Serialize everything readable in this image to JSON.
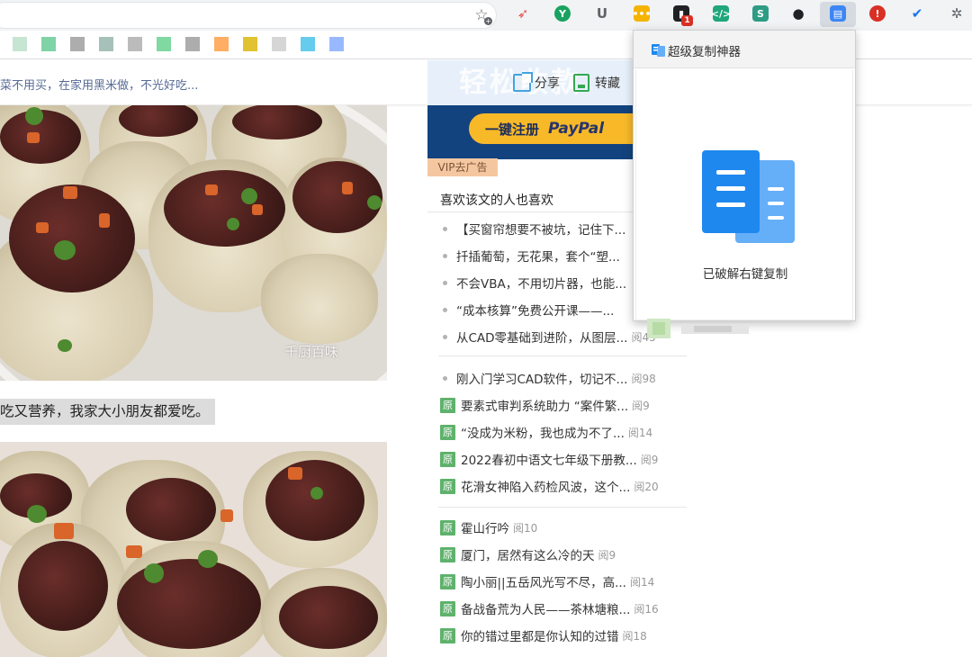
{
  "browser": {
    "extensions": [
      {
        "name": "rocket-extension",
        "color": "#e84b4b",
        "glyph": "➶"
      },
      {
        "name": "y-extension",
        "color": "#1aa260",
        "glyph": "Y"
      },
      {
        "name": "shield-extension",
        "color": "#5f6368",
        "glyph": "U"
      },
      {
        "name": "yellow-dots-extension",
        "color": "#f4b400",
        "glyph": "•••"
      },
      {
        "name": "black-extension",
        "color": "#202124",
        "glyph": "▮"
      },
      {
        "name": "code-extension",
        "color": "#1fa67a",
        "glyph": "</>"
      },
      {
        "name": "s-extension",
        "color": "#2e9c85",
        "glyph": "S"
      },
      {
        "name": "spy-extension",
        "color": "#202124",
        "glyph": "●"
      },
      {
        "name": "copy-extension",
        "color": "#3d86f4",
        "glyph": "▤"
      },
      {
        "name": "alert-extension",
        "color": "#d93025",
        "glyph": "!"
      },
      {
        "name": "check-extension",
        "color": "#1a73e8",
        "glyph": "✔"
      },
      {
        "name": "puzzle-extension",
        "color": "#5f6368",
        "glyph": "✲"
      }
    ],
    "badge_count": "1",
    "bookmark_colors": [
      "#b9dfc8",
      "#5fc890",
      "#999999",
      "#8fb1a8",
      "#aaaaaa",
      "#5fcf8a",
      "#999999",
      "#ff9a3c",
      "#d9b300",
      "#cccccc",
      "#3fbfe8",
      "#7fa7ff"
    ]
  },
  "article": {
    "header_text": "菜不用买，在家用黑米做，不光好吃...",
    "share_label": "分享",
    "collect_label": "转藏",
    "caption": "吃又营养，我家大小朋友都爱吃。",
    "watermark": "千厨百味"
  },
  "ad": {
    "slogan": "轻松收款",
    "cta": "一键注册",
    "paypal": "PayPal",
    "vip_tag": "VIP去广告"
  },
  "related": {
    "title": "喜欢该文的人也喜欢",
    "group1": [
      {
        "text": "【买窗帘想要不被坑，记住下...",
        "reads": ""
      },
      {
        "text": "扦插葡萄，无花果，套个“塑...",
        "reads": ""
      },
      {
        "text": "不会VBA，不用切片器，也能...",
        "reads": ""
      },
      {
        "text": "“成本核算”免费公开课——...",
        "reads": ""
      },
      {
        "text": "从CAD零基础到进阶，从图层...",
        "reads": "阅45"
      }
    ],
    "group2": [
      {
        "text": "刚入门学习CAD软件，切记不...",
        "reads": "阅98",
        "original": false
      },
      {
        "text": "要素式审判系统助力 “案件繁...",
        "reads": "阅9",
        "original": true
      },
      {
        "text": "“没成为米粉，我也成为不了...",
        "reads": "阅14",
        "original": true
      },
      {
        "text": "2022春初中语文七年级下册教...",
        "reads": "阅9",
        "original": true
      },
      {
        "text": "花滑女神陷入药检风波，这个...",
        "reads": "阅20",
        "original": true
      }
    ],
    "group3": [
      {
        "text": "霍山行吟",
        "reads": "阅10"
      },
      {
        "text": "厦门，居然有这么冷的天",
        "reads": "阅9"
      },
      {
        "text": "陶小丽||五岳风光写不尽，高...",
        "reads": "阅14"
      },
      {
        "text": "备战备荒为人民——茶林塘粮...",
        "reads": "阅16"
      },
      {
        "text": "你的错过里都是你认知的过错",
        "reads": "阅18"
      }
    ],
    "original_tag": "原"
  },
  "popup": {
    "title": "超级复制神器",
    "status": "已破解右键复制"
  }
}
